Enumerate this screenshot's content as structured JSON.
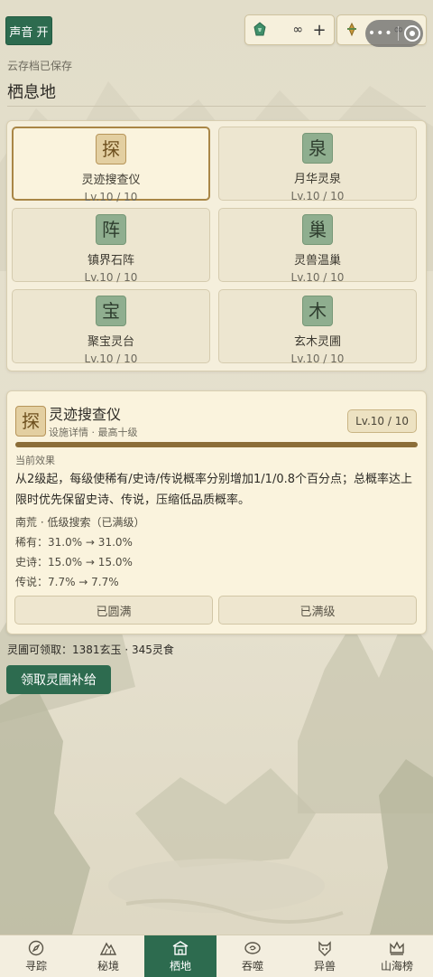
{
  "top": {
    "sound_button": "声音 开",
    "resource1_value": "∞",
    "resource1_plus": "+",
    "resource2_value": "∞",
    "saved_status": "云存档已保存",
    "page_title": "栖息地"
  },
  "facilities": [
    {
      "glyph": "探",
      "name": "灵迹搜查仪",
      "level": "Lv.10 / 10",
      "selected": true
    },
    {
      "glyph": "泉",
      "name": "月华灵泉",
      "level": "Lv.10 / 10",
      "selected": false
    },
    {
      "glyph": "阵",
      "name": "镇界石阵",
      "level": "Lv.10 / 10",
      "selected": false
    },
    {
      "glyph": "巢",
      "name": "灵兽温巢",
      "level": "Lv.10 / 10",
      "selected": false
    },
    {
      "glyph": "宝",
      "name": "聚宝灵台",
      "level": "Lv.10 / 10",
      "selected": false
    },
    {
      "glyph": "木",
      "name": "玄木灵圃",
      "level": "Lv.10 / 10",
      "selected": false
    }
  ],
  "detail": {
    "glyph": "探",
    "name": "灵迹搜查仪",
    "subtitle": "设施详情 · 最高十级",
    "level": "Lv.10 / 10",
    "progress": 1.0,
    "effect_heading": "当前效果",
    "effect_desc": "从2级起，每级使稀有/史诗/传说概率分别增加1/1/0.8个百分点；总概率达上限时优先保留史诗、传说，压缩低品质概率。",
    "lines": [
      "南荒 · 低级搜索（已满级）",
      "稀有：31.0% → 31.0%",
      "史诗：15.0% → 15.0%",
      "传说：7.7% → 7.7%"
    ],
    "button_left": "已圆满",
    "button_right": "已满级"
  },
  "claim": {
    "info": "灵圃可领取：1381玄玉 · 345灵食",
    "button": "领取灵圃补给"
  },
  "tabs": [
    {
      "label": "寻踪",
      "icon": "compass-icon",
      "active": false
    },
    {
      "label": "秘境",
      "icon": "mountain-icon",
      "active": false
    },
    {
      "label": "栖地",
      "icon": "house-icon",
      "active": true
    },
    {
      "label": "吞噬",
      "icon": "swirl-icon",
      "active": false
    },
    {
      "label": "异兽",
      "icon": "beast-icon",
      "active": false
    },
    {
      "label": "山海榜",
      "icon": "crown-icon",
      "active": false
    }
  ],
  "colors": {
    "accent_green": "#2d6b4f",
    "gold": "#8b6d38",
    "panel": "#faf3dd"
  }
}
